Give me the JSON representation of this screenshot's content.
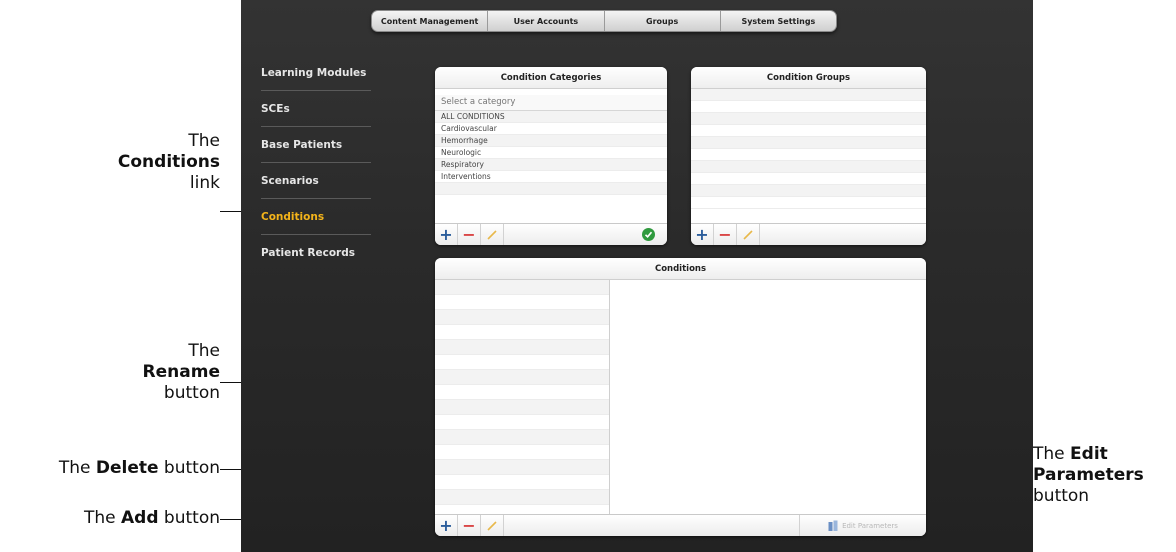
{
  "top_nav": {
    "tabs": [
      "Content Management",
      "User Accounts",
      "Groups",
      "System Settings"
    ]
  },
  "sidebar": {
    "items": [
      {
        "label": "Learning Modules",
        "active": false
      },
      {
        "label": "SCEs",
        "active": false
      },
      {
        "label": "Base Patients",
        "active": false
      },
      {
        "label": "Scenarios",
        "active": false
      },
      {
        "label": "Conditions",
        "active": true
      },
      {
        "label": "Patient Records",
        "active": false
      }
    ]
  },
  "categories_panel": {
    "title": "Condition Categories",
    "search_placeholder": "Select a category",
    "items": [
      "ALL CONDITIONS",
      "Cardiovascular",
      "Hemorrhage",
      "Neurologic",
      "Respiratory",
      "Interventions"
    ]
  },
  "groups_panel": {
    "title": "Condition Groups"
  },
  "conditions_panel": {
    "title": "Conditions",
    "edit_parameters_label": "Edit Parameters"
  },
  "toolbar_symbols": {
    "add": "+",
    "delete": "−"
  },
  "callouts": {
    "conditions_link": {
      "the": "The",
      "bold": "Conditions",
      "rest": "link"
    },
    "rename_button": {
      "the": "The",
      "bold": "Rename",
      "rest": "button"
    },
    "delete_button": {
      "the": "The",
      "bold": "Delete",
      "rest": "button"
    },
    "add_button": {
      "the": "The",
      "bold": "Add",
      "rest": "button"
    },
    "edit_parameters_button": {
      "the": "The",
      "bold1": "Edit",
      "bold2": "Parameters",
      "rest": "button"
    }
  },
  "colors": {
    "accent_active": "#f4b41a",
    "add_blue": "#2b5d9b",
    "delete_red": "#d94343",
    "ok_green": "#2f9a3e"
  }
}
